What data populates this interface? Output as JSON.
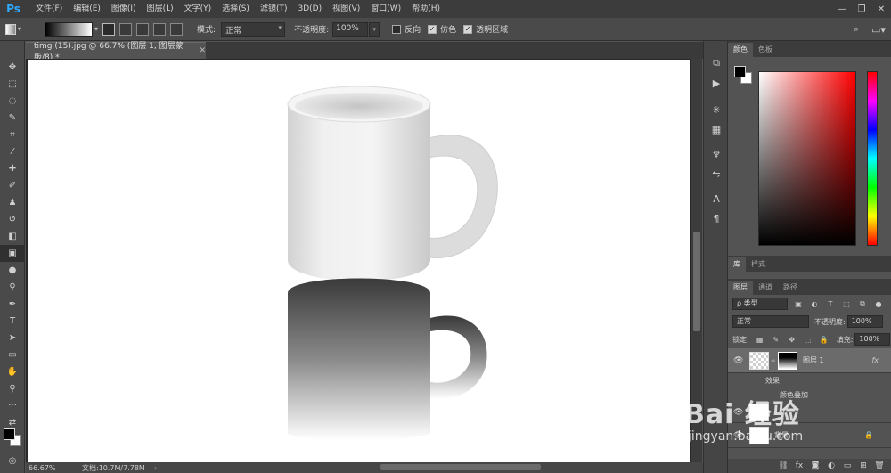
{
  "app": {
    "logo": "Ps",
    "menu": [
      "文件(F)",
      "编辑(E)",
      "图像(I)",
      "图层(L)",
      "文字(Y)",
      "选择(S)",
      "滤镜(T)",
      "3D(D)",
      "视图(V)",
      "窗口(W)",
      "帮助(H)"
    ],
    "window_controls": [
      "—",
      "❐",
      "✕"
    ]
  },
  "options": {
    "mode_label": "模式:",
    "mode_value": "正常",
    "opacity_label": "不透明度:",
    "opacity_value": "100%",
    "reverse_label": "反向",
    "dither_label": "仿色",
    "transparency_label": "透明区域",
    "reverse_checked": false,
    "dither_checked": true,
    "transparency_checked": true
  },
  "document": {
    "tab_title": "timg (15).jpg @ 66.7% (图层 1, 图层蒙版/8) *",
    "zoom": "66.67%",
    "doc_info": "文档:10.7M/7.78M"
  },
  "color_panel": {
    "tabs": [
      "颜色",
      "色板"
    ],
    "foreground": "#000000",
    "background": "#ffffff"
  },
  "library_panel": {
    "tabs": [
      "库",
      "样式"
    ]
  },
  "layers_panel": {
    "tabs": [
      "图层",
      "通道",
      "路径"
    ],
    "filter_label": "ρ 类型",
    "blend_mode": "正常",
    "opacity_label": "不透明度:",
    "opacity_value": "100%",
    "lock_label": "锁定:",
    "fill_label": "填充:",
    "fill_value": "100%",
    "layers": [
      {
        "name": "图层 1",
        "fx": "fx"
      }
    ],
    "effects_label": "效果",
    "effect_color_overlay": "颜色叠加",
    "background_layer": "背景"
  },
  "watermark": {
    "text": "Bai 经验",
    "sub": "jingyan.baidu.com"
  }
}
